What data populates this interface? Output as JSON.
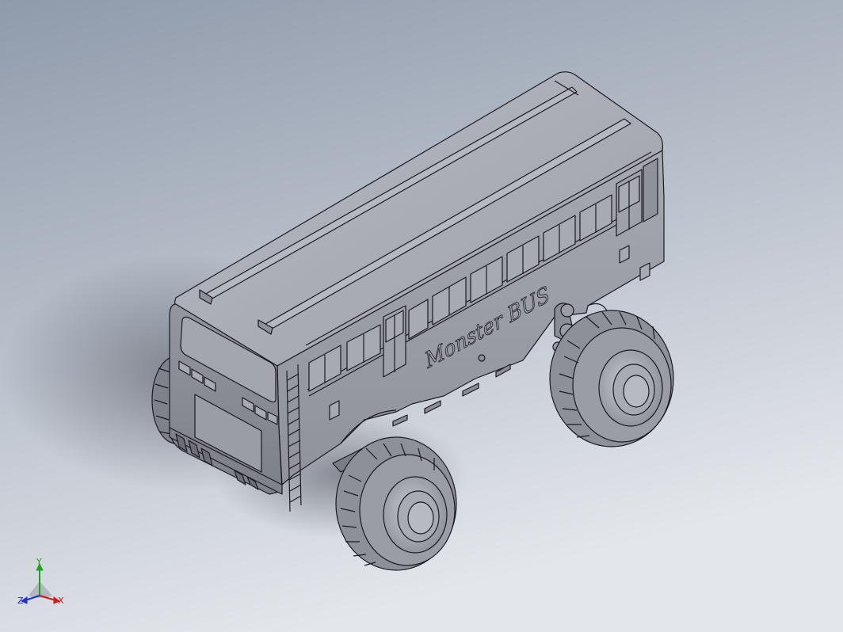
{
  "viewport": {
    "background_top": "#8f9aab",
    "background_bottom": "#e3e6eb",
    "model_fill": "#9a9ca6",
    "model_dark": "#6d6f78",
    "model_light": "#c4c6ce",
    "edge_color": "#1a1a1f"
  },
  "model": {
    "logo_text": "Monster BUS"
  },
  "triad": {
    "x_label": "X",
    "y_label": "Y",
    "z_label": "Z",
    "x_color": "#d01818",
    "y_color": "#1fa31f",
    "z_color": "#2030c8"
  }
}
